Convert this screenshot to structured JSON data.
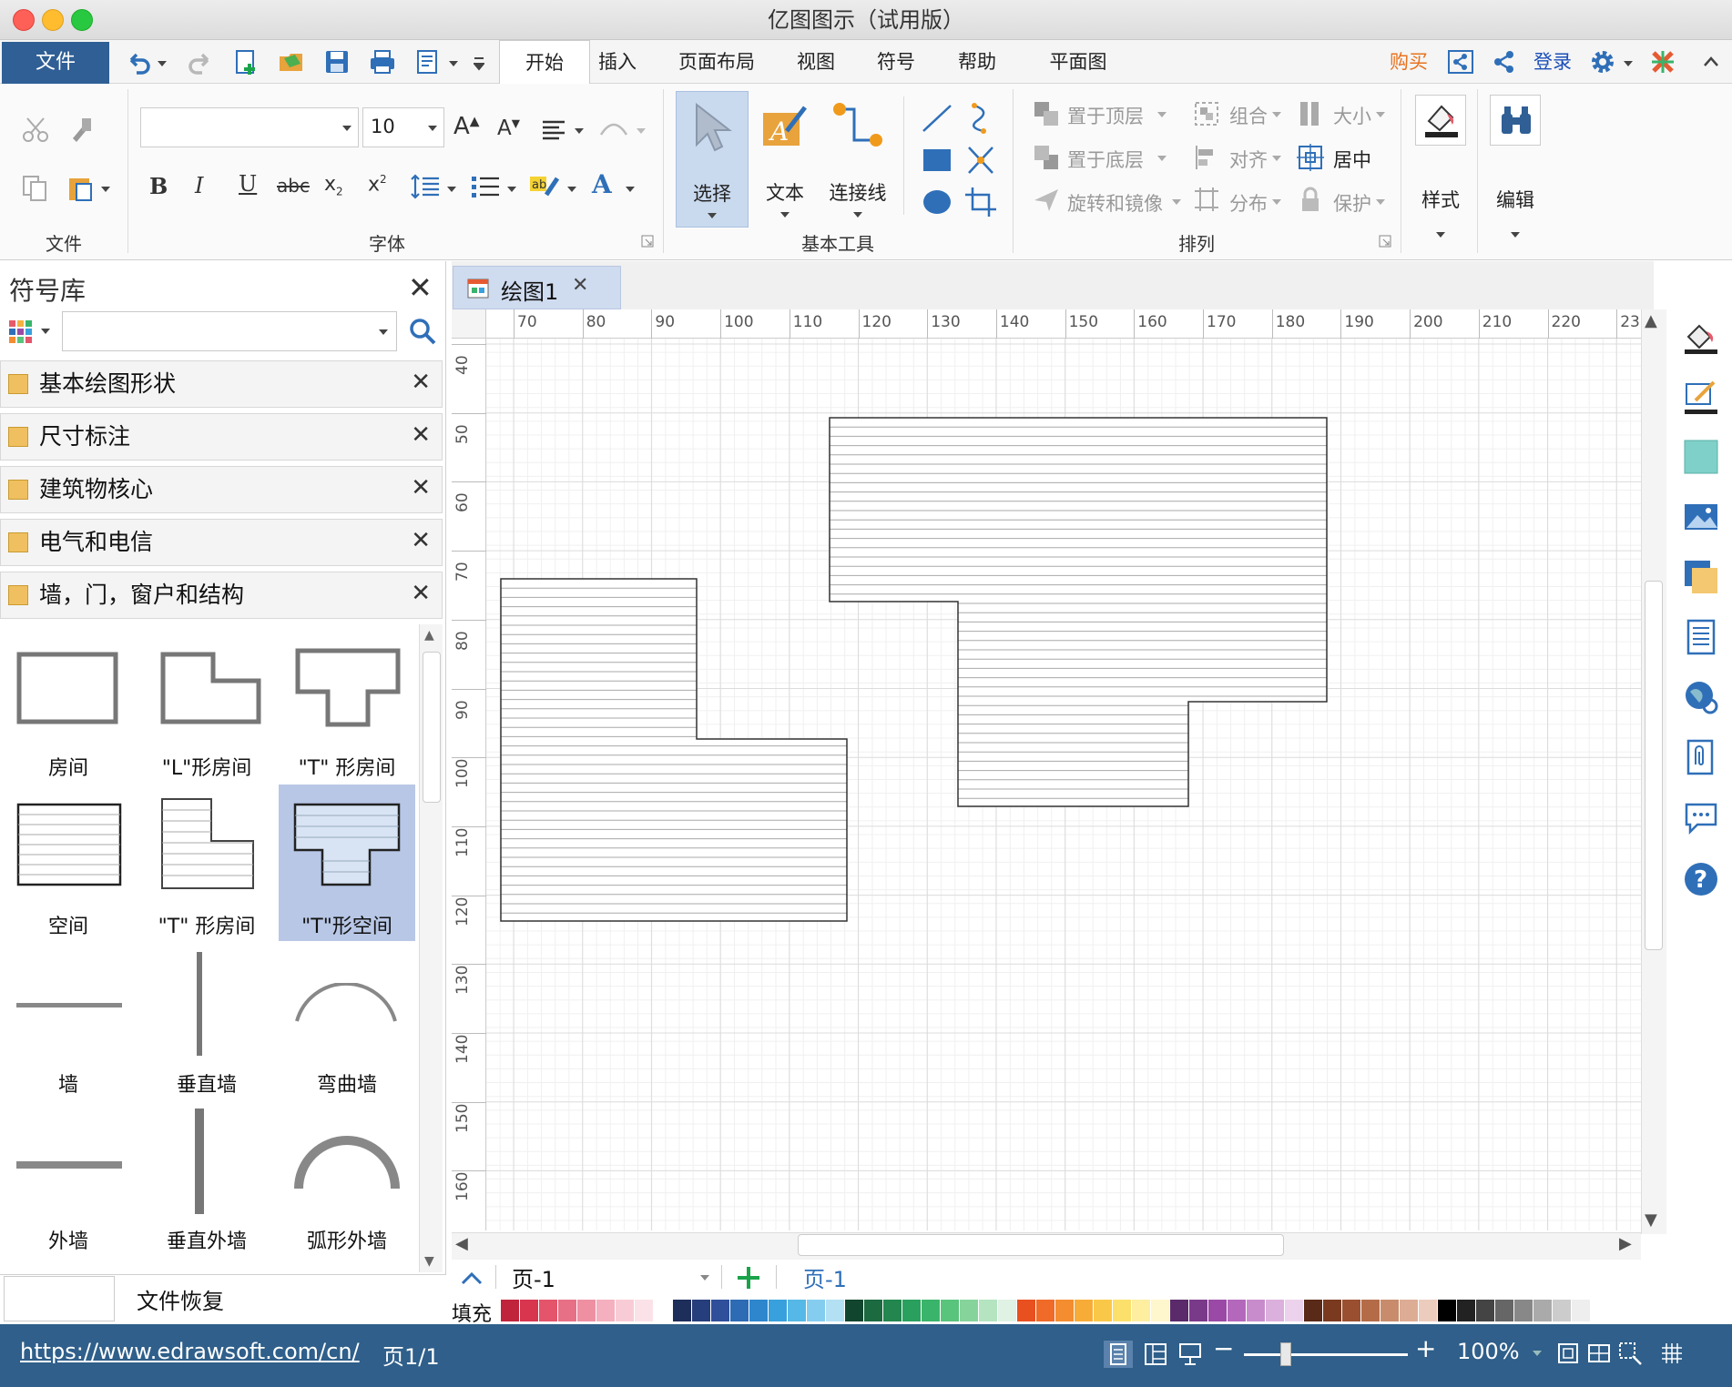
{
  "window": {
    "title": "亿图图示（试用版）"
  },
  "quick_access": {
    "file_label": "文件"
  },
  "tabs": [
    {
      "label": "开始",
      "active": true
    },
    {
      "label": "插入"
    },
    {
      "label": "页面布局"
    },
    {
      "label": "视图"
    },
    {
      "label": "符号"
    },
    {
      "label": "帮助"
    },
    {
      "label": "平面图"
    }
  ],
  "account": {
    "buy": "购买",
    "login": "登录"
  },
  "ribbon": {
    "groups": {
      "file": "文件",
      "font": "字体",
      "basic_tools": "基本工具",
      "arrange": "排列"
    },
    "font": {
      "family_value": "",
      "size_value": "10"
    },
    "tools": {
      "select": "选择",
      "text": "文本",
      "connector": "连接线"
    },
    "arrange": {
      "bring_front": "置于顶层",
      "send_back": "置于底层",
      "rotate_mirror": "旋转和镜像",
      "group": "组合",
      "align": "对齐",
      "distribute": "分布",
      "size": "大小",
      "center": "居中",
      "protect": "保护"
    },
    "style": "样式",
    "edit": "编辑"
  },
  "library": {
    "title": "符号库",
    "search_value": "",
    "categories": [
      {
        "label": "基本绘图形状"
      },
      {
        "label": "尺寸标注"
      },
      {
        "label": "建筑物核心"
      },
      {
        "label": "电气和电信"
      },
      {
        "label": "墙，门，窗户和结构"
      }
    ],
    "shapes": [
      {
        "label": "房间"
      },
      {
        "label": "\"L\"形房间"
      },
      {
        "label": "\"T\" 形房间"
      },
      {
        "label": "空间"
      },
      {
        "label": "\"T\" 形房间"
      },
      {
        "label": "\"T\"形空间",
        "selected": true
      },
      {
        "label": "墙"
      },
      {
        "label": "垂直墙"
      },
      {
        "label": "弯曲墙"
      },
      {
        "label": "外墙"
      },
      {
        "label": "垂直外墙"
      },
      {
        "label": "弧形外墙"
      }
    ],
    "recovery": "文件恢复"
  },
  "document": {
    "tab_title": "绘图1"
  },
  "rulers": {
    "horizontal": [
      "70",
      "80",
      "90",
      "100",
      "110",
      "120",
      "130",
      "140",
      "150",
      "160",
      "170",
      "180",
      "190",
      "200",
      "210",
      "220",
      "23"
    ],
    "vertical": [
      "40",
      "50",
      "60",
      "70",
      "80",
      "90",
      "100",
      "110",
      "120",
      "130",
      "140",
      "150",
      "160"
    ]
  },
  "pages": {
    "current": "页-1",
    "tab": "页-1"
  },
  "palette": {
    "label": "填充",
    "colors": [
      "#c0243c",
      "#d8354f",
      "#e4546a",
      "#e87086",
      "#ee90a2",
      "#f4b0be",
      "#f8ccd6",
      "#fbe2e8",
      "#ffffff",
      "#1e2e5a",
      "#263e7c",
      "#2f4f9a",
      "#2d6bb4",
      "#2e86cc",
      "#38a0dc",
      "#56b8e6",
      "#84cdee",
      "#b4e0f4",
      "#12452e",
      "#1c6a40",
      "#22864e",
      "#2aa05e",
      "#3ab46a",
      "#58c47c",
      "#86d49c",
      "#b4e4c0",
      "#dff2e4",
      "#e85020",
      "#f06a28",
      "#f48c30",
      "#f8ac38",
      "#fac848",
      "#fce06c",
      "#fdeea0",
      "#fef6cc",
      "#5a2a6a",
      "#7a3a8a",
      "#9a4aa6",
      "#b468bc",
      "#c88ccc",
      "#dcb0dc",
      "#ecd2ec",
      "#5a2a18",
      "#7a3a20",
      "#9a5030",
      "#b46c48",
      "#c88c6c",
      "#dcac94",
      "#ecccbc",
      "#000000",
      "#222222",
      "#444444",
      "#666666",
      "#888888",
      "#aaaaaa",
      "#cccccc",
      "#eeeeee"
    ]
  },
  "status": {
    "url": "https://www.edrawsoft.com/cn/",
    "page": "页1/1",
    "zoom": "100%"
  }
}
